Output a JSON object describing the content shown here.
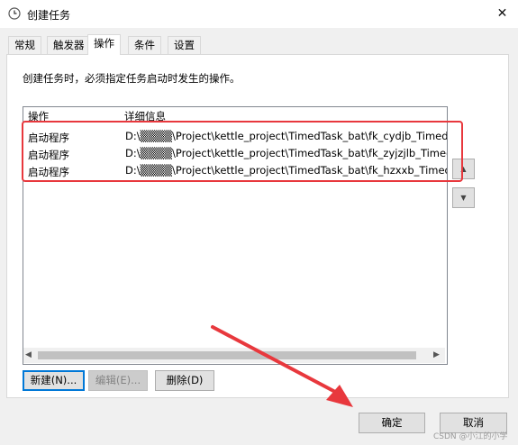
{
  "window": {
    "title": "创建任务",
    "close_symbol": "✕"
  },
  "tabs": [
    {
      "label": "常规"
    },
    {
      "label": "触发器"
    },
    {
      "label": "操作",
      "active": true
    },
    {
      "label": "条件"
    },
    {
      "label": "设置"
    }
  ],
  "panel": {
    "description": "创建任务时，必须指定任务启动时发生的操作。"
  },
  "listview": {
    "columns": [
      "操作",
      "详细信息"
    ],
    "rows": [
      {
        "action": "启动程序",
        "details": "D:\\▒▒▒▒\\Project\\kettle_project\\TimedTask_bat\\fk_cydjb_TimedTask"
      },
      {
        "action": "启动程序",
        "details": "D:\\▒▒▒▒\\Project\\kettle_project\\TimedTask_bat\\fk_zyjzjlb_TimedTask"
      },
      {
        "action": "启动程序",
        "details": "D:\\▒▒▒▒\\Project\\kettle_project\\TimedTask_bat\\fk_hzxxb_TimedTask"
      }
    ]
  },
  "buttons": {
    "new": "新建(N)...",
    "edit": "编辑(E)...",
    "delete": "删除(D)",
    "ok": "确定",
    "cancel": "取消"
  },
  "watermark": "CSDN @小江的小学",
  "colors": {
    "annotation_red": "#e8383d",
    "focus_blue": "#0078d7"
  }
}
